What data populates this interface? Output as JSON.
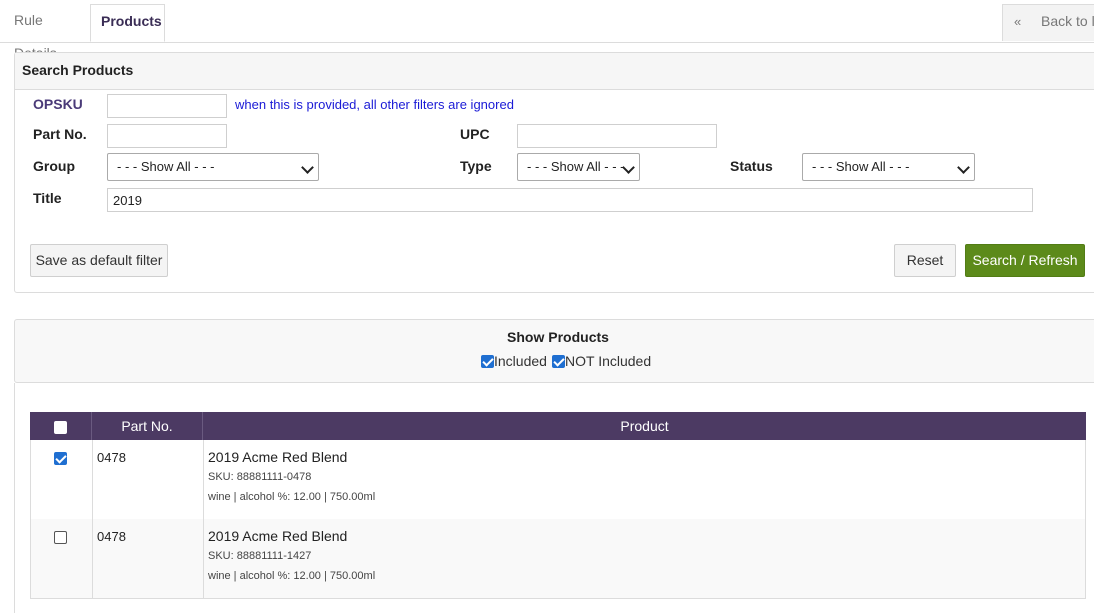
{
  "tabs": [
    {
      "label": "Rule Details",
      "active": false
    },
    {
      "label": "Products",
      "active": true
    }
  ],
  "back": {
    "icon": "double-chevron-left-icon",
    "chevron": "«",
    "label": "Back to lis"
  },
  "search": {
    "title": "Search Products",
    "opsku": {
      "label": "OPSKU",
      "value": "",
      "hint": "when this is provided, all other filters are ignored"
    },
    "part_no": {
      "label": "Part No.",
      "value": ""
    },
    "upc": {
      "label": "UPC",
      "value": ""
    },
    "group": {
      "label": "Group",
      "selected": "- - - Show All - - -"
    },
    "type": {
      "label": "Type",
      "selected": "- - - Show All - - -"
    },
    "status": {
      "label": "Status",
      "selected": "- - - Show All - - -"
    },
    "title_field": {
      "label": "Title",
      "value": "2019"
    },
    "save_default_label": "Save as default filter",
    "reset_label": "Reset",
    "search_label": "Search / Refresh",
    "search_color": "#5c8a1a"
  },
  "show_products": {
    "title": "Show Products",
    "included": {
      "label": "Included",
      "checked": true
    },
    "not_included": {
      "label": "NOT Included",
      "checked": true
    }
  },
  "table": {
    "header_color": "#4c3a63",
    "columns": [
      "",
      "Part No.",
      "Product"
    ],
    "rows": [
      {
        "checked": true,
        "part_no": "0478",
        "title": "2019 Acme Red Blend",
        "sku": "SKU: 88881111-0478",
        "meta": "wine | alcohol %: 12.00 | 750.00ml"
      },
      {
        "checked": false,
        "part_no": "0478",
        "title": "2019 Acme Red Blend",
        "sku": "SKU: 88881111-1427",
        "meta": "wine | alcohol %: 12.00 | 750.00ml"
      }
    ]
  }
}
